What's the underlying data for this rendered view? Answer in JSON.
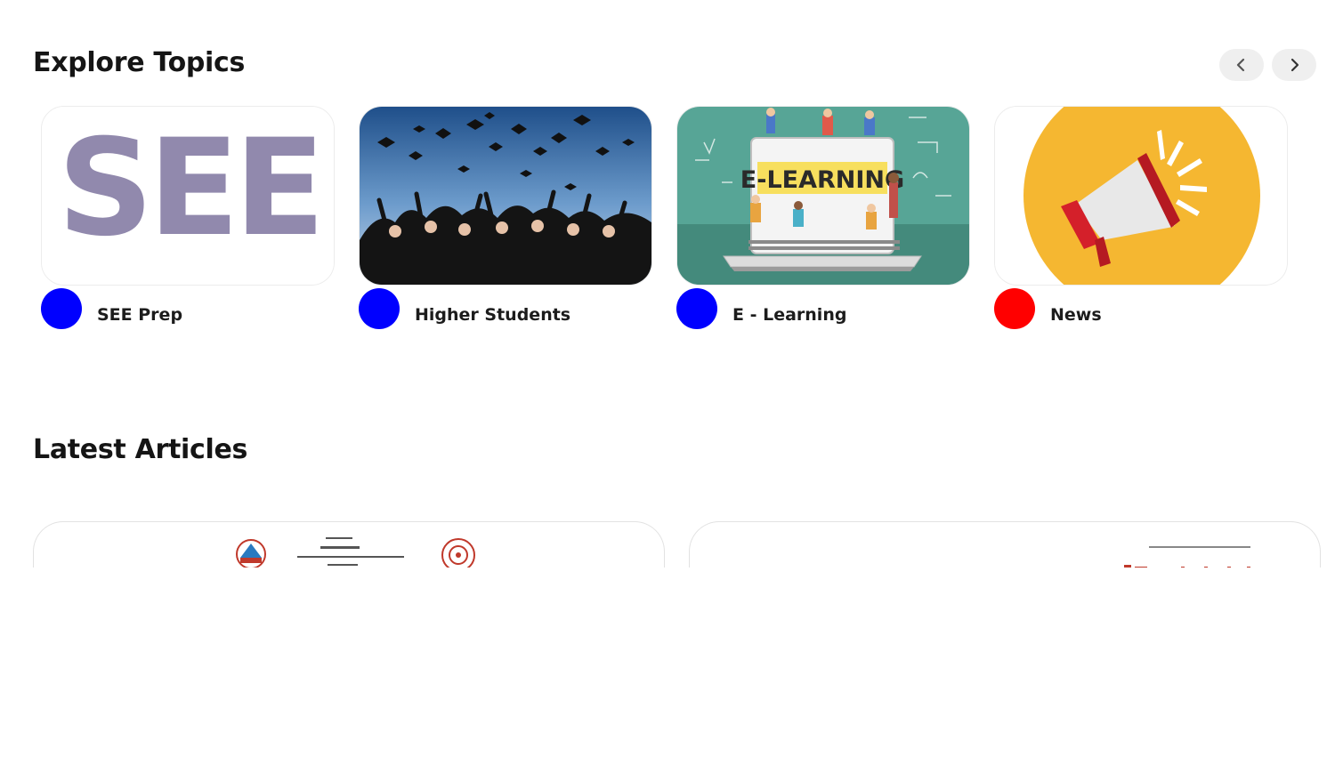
{
  "explore": {
    "title": "Explore Topics",
    "nav": {
      "prev_icon": "chevron-left-icon",
      "next_icon": "chevron-right-icon"
    },
    "topics": [
      {
        "label": "SEE Prep",
        "dot_color": "#0000ff",
        "image_text": "SEE",
        "image": "see-logo-image"
      },
      {
        "label": "Higher Students",
        "dot_color": "#0000ff",
        "image": "graduation-caps-photo"
      },
      {
        "label": "E - Learning",
        "dot_color": "#0000ff",
        "image_text": "E-LEARNING",
        "image": "e-learning-illustration"
      },
      {
        "label": "News",
        "dot_color": "#ff0000",
        "image": "megaphone-illustration"
      }
    ]
  },
  "latest": {
    "title": "Latest Articles"
  },
  "colors": {
    "see_text": "#9189ad",
    "elearning_bg": "#57a596",
    "news_circle": "#f5b731",
    "megaphone_red": "#d4202a"
  }
}
